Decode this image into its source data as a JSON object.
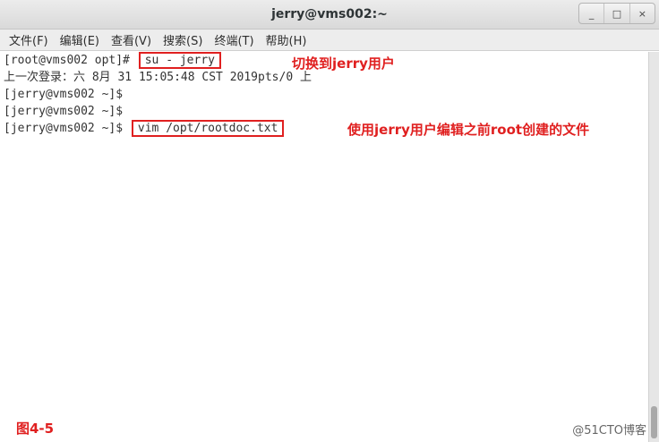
{
  "window": {
    "title": "jerry@vms002:~",
    "controls": {
      "minimize": "_",
      "maximize": "□",
      "close": "×"
    }
  },
  "menu": {
    "items": [
      "文件(F)",
      "编辑(E)",
      "查看(V)",
      "搜索(S)",
      "终端(T)",
      "帮助(H)"
    ]
  },
  "terminal": {
    "lines": [
      {
        "prompt": "[root@vms002 opt]# ",
        "command": "su - jerry"
      },
      {
        "text": "上一次登录：六 8月 31 15:05:48 CST 2019pts/0 上"
      },
      {
        "prompt": "[jerry@vms002 ~]$ "
      },
      {
        "prompt": "[jerry@vms002 ~]$ "
      },
      {
        "prompt": "[jerry@vms002 ~]$ ",
        "command": "vim /opt/rootdoc.txt"
      }
    ]
  },
  "annotations": {
    "switch_user": "切换到jerry用户",
    "edit_file": "使用jerry用户编辑之前root创建的文件",
    "figure": "图4-5"
  },
  "watermark": "@51CTO博客",
  "colors": {
    "annotation_red": "#e02020",
    "terminal_text": "#333333",
    "terminal_bg": "#ffffff"
  }
}
